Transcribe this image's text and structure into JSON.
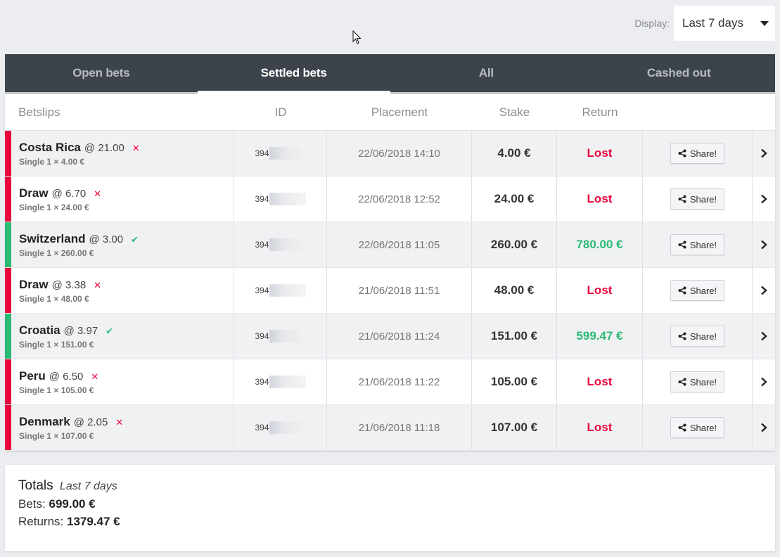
{
  "display": {
    "label": "Display:",
    "value": "Last 7 days"
  },
  "tabs": [
    {
      "label": "Open bets",
      "active": false
    },
    {
      "label": "Settled bets",
      "active": true
    },
    {
      "label": "All",
      "active": false
    },
    {
      "label": "Cashed out",
      "active": false
    }
  ],
  "table": {
    "headers": {
      "betslips": "Betslips",
      "id": "ID",
      "placement": "Placement",
      "stake": "Stake",
      "return": "Return"
    },
    "share_label": "Share!",
    "rows": [
      {
        "selection": "Costa Rica",
        "odds": "@ 21.00",
        "detail": "Single 1 × 4.00 €",
        "id_prefix": "394",
        "placement": "22/06/2018 14:10",
        "stake": "4.00 €",
        "return": "Lost",
        "status": "lost"
      },
      {
        "selection": "Draw",
        "odds": "@ 6.70",
        "detail": "Single 1 × 24.00 €",
        "id_prefix": "394",
        "placement": "22/06/2018 12:52",
        "stake": "24.00 €",
        "return": "Lost",
        "status": "lost"
      },
      {
        "selection": "Switzerland",
        "odds": "@ 3.00",
        "detail": "Single 1 × 260.00 €",
        "id_prefix": "394",
        "placement": "22/06/2018 11:05",
        "stake": "260.00 €",
        "return": "780.00 €",
        "status": "won"
      },
      {
        "selection": "Draw",
        "odds": "@ 3.38",
        "detail": "Single 1 × 48.00 €",
        "id_prefix": "394",
        "placement": "21/06/2018 11:51",
        "stake": "48.00 €",
        "return": "Lost",
        "status": "lost"
      },
      {
        "selection": "Croatia",
        "odds": "@ 3.97",
        "detail": "Single 1 × 151.00 €",
        "id_prefix": "394",
        "placement": "21/06/2018 11:24",
        "stake": "151.00 €",
        "return": "599.47 €",
        "status": "won"
      },
      {
        "selection": "Peru",
        "odds": "@ 6.50",
        "detail": "Single 1 × 105.00 €",
        "id_prefix": "394",
        "placement": "21/06/2018 11:22",
        "stake": "105.00 €",
        "return": "Lost",
        "status": "lost"
      },
      {
        "selection": "Denmark",
        "odds": "@ 2.05",
        "detail": "Single 1 × 107.00 €",
        "id_prefix": "394",
        "placement": "21/06/2018 11:18",
        "stake": "107.00 €",
        "return": "Lost",
        "status": "lost"
      }
    ]
  },
  "totals": {
    "title": "Totals",
    "period": "Last 7 days",
    "bets_label": "Bets:",
    "bets_value": "699.00 €",
    "returns_label": "Returns:",
    "returns_value": "1379.47 €"
  },
  "colors": {
    "lost": "#e8063c",
    "won": "#2aba74",
    "tab_bar": "#3d434b"
  }
}
